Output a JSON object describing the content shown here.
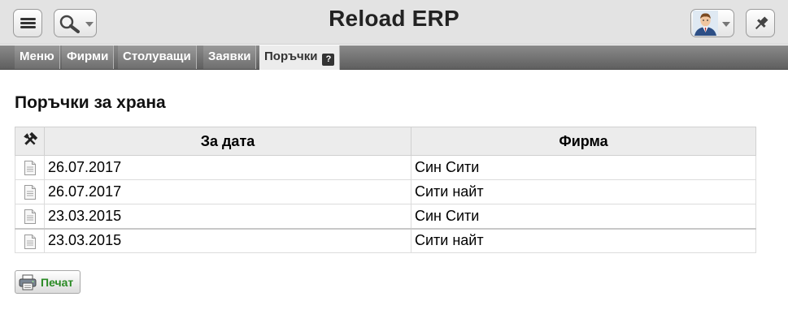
{
  "header": {
    "app_title": "Reload ERP"
  },
  "tabs": [
    {
      "label": "Меню"
    },
    {
      "label": "Фирми"
    },
    {
      "label": "Столуващи"
    },
    {
      "label": "Заявки"
    },
    {
      "label": "Поръчки",
      "active": true
    }
  ],
  "page": {
    "heading": "Поръчки за храна"
  },
  "table": {
    "columns": [
      "За дата",
      "Фирма"
    ],
    "rows": [
      {
        "date": "26.07.2017",
        "company": "Син Сити"
      },
      {
        "date": "26.07.2017",
        "company": "Сити найт"
      },
      {
        "date": "23.03.2015",
        "company": "Син Сити"
      },
      {
        "date": "23.03.2015",
        "company": "Сити найт"
      }
    ]
  },
  "actions": {
    "print_label": "Печат"
  },
  "icons": {
    "menu": "hamburger-icon",
    "search": "search-icon",
    "user": "user-avatar-icon",
    "pin": "pin-icon",
    "help": "help-icon",
    "tools": "tools-icon",
    "row": "document-icon",
    "print": "printer-icon"
  },
  "colors": {
    "print_label": "#2a8a24",
    "tabbar": "#6e6e6e",
    "active_tab": "#ececec"
  }
}
